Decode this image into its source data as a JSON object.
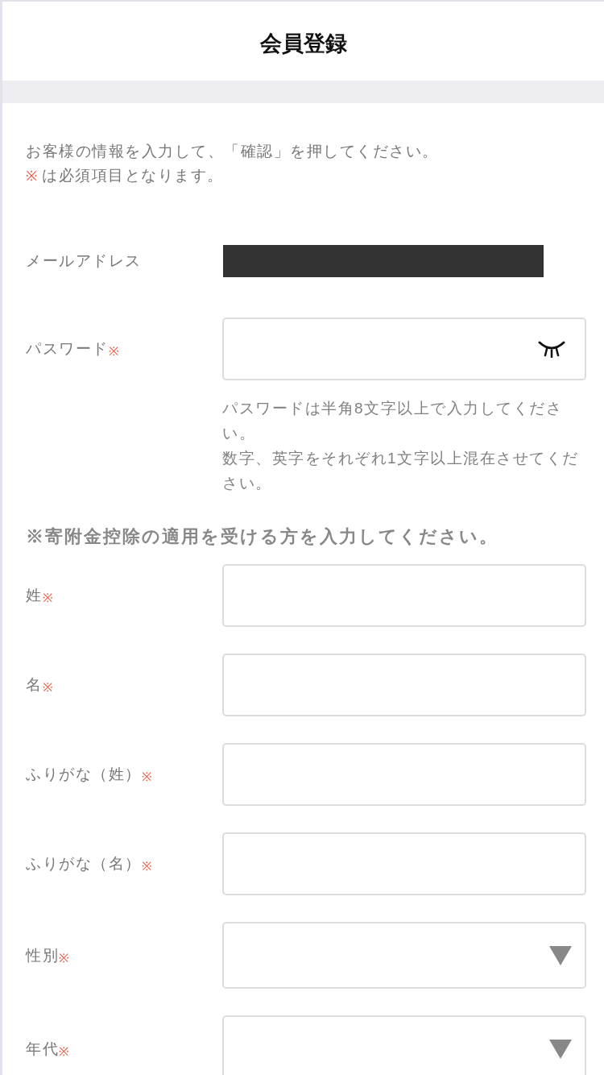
{
  "header": {
    "title": "会員登録"
  },
  "intro": {
    "text": "お客様の情報を入力して、「確認」を押してください。",
    "note_mark": "※",
    "note": "は必須項目となります。"
  },
  "account_fields": [
    {
      "kind": "redacted",
      "label": "メールアドレス"
    },
    {
      "kind": "password",
      "label": "パスワード",
      "required_mark": "※",
      "revealed": false,
      "hints": [
        "パスワードは半角8文字以上で入力してください。",
        "数字、英字をそれぞれ1文字以上混在させてください。"
      ]
    }
  ],
  "section_heading": "※寄附金控除の適用を受ける方を入力してください。",
  "fields": [
    {
      "kind": "text",
      "label": "姓",
      "required_mark": "※"
    },
    {
      "kind": "text",
      "label": "名",
      "required_mark": "※"
    },
    {
      "kind": "text",
      "label": "ふりがな（姓）",
      "required_mark": "※"
    },
    {
      "kind": "text",
      "label": "ふりがな（名）",
      "required_mark": "※"
    },
    {
      "kind": "select",
      "label": "性別",
      "required_mark": "※"
    },
    {
      "kind": "select",
      "label": "年代",
      "required_mark": "※"
    }
  ]
}
